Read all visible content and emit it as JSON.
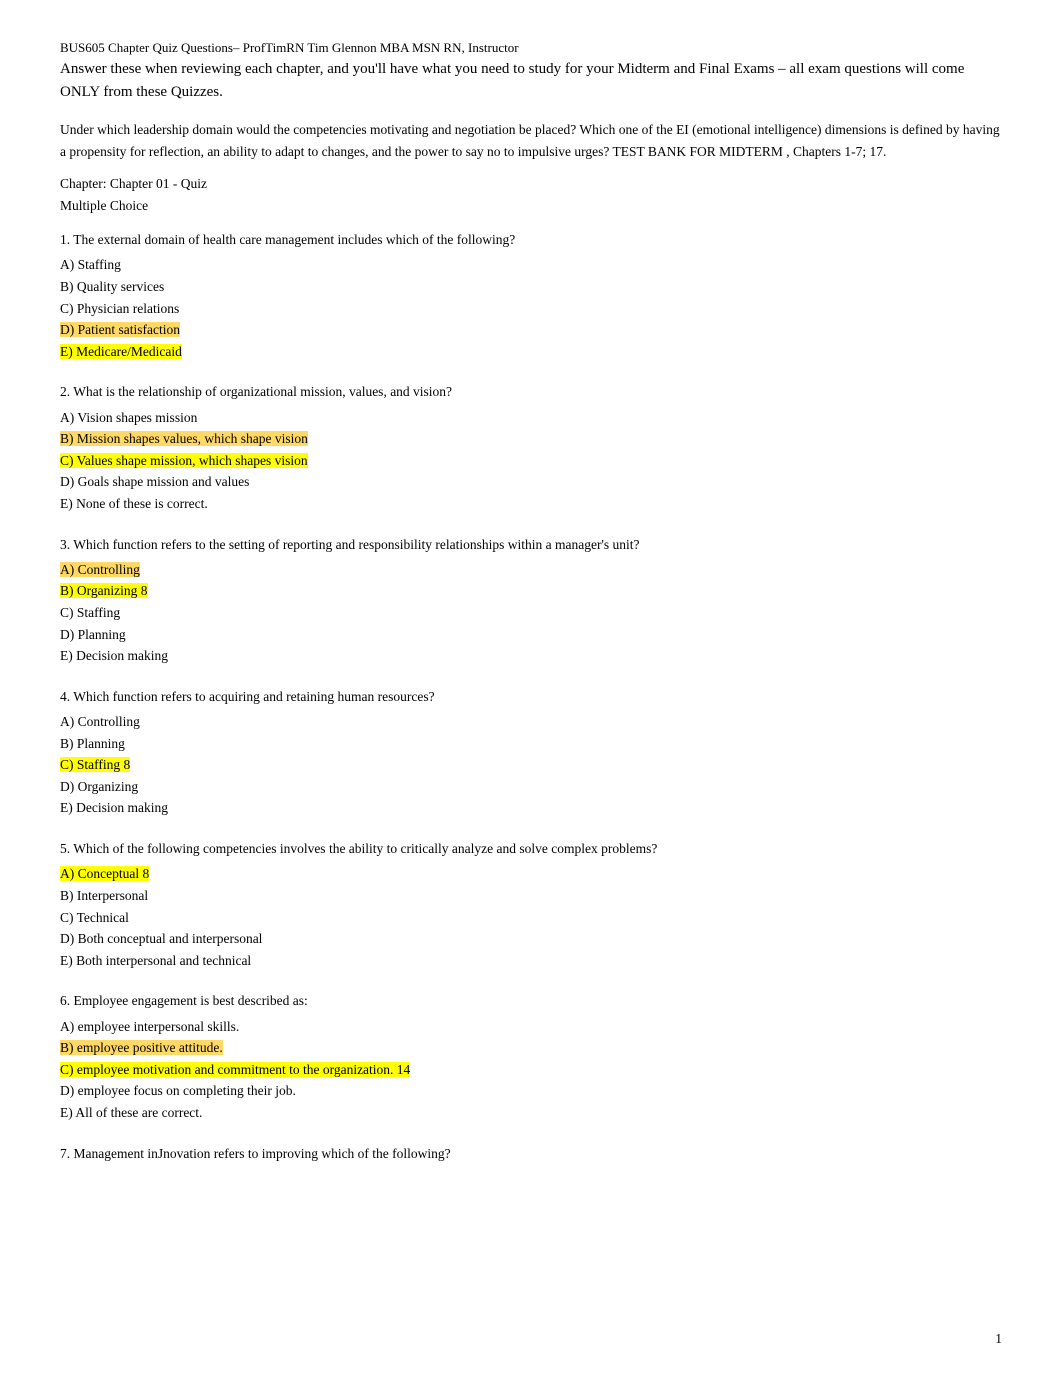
{
  "header": {
    "line1": "BUS605 Chapter Quiz Questions– ProfTimRN Tim Glennon MBA MSN RN, Instructor",
    "line2": "Answer these when reviewing each chapter, and you'll have what you need to study for your    Midterm and Final Exams – all exam questions will come ONLY from these Quizzes."
  },
  "intro": {
    "text": "Under which leadership domain would the competencies      motivating and negotiation  be placed? Which one of the EI (emotional intelligence) dimensions is defined by having a propensity for reflection, an ability to adapt to changes, and the power to say no to impulsive urges?       TEST BANK FOR MIDTERM , Chapters 1-7; 17."
  },
  "chapter_label": "Chapter: Chapter 01 - Quiz",
  "type_label": "Multiple Choice",
  "questions": [
    {
      "number": "1",
      "text": "The external domain of health care management includes which of the following?",
      "options": [
        {
          "letter": "A",
          "text": "Staffing",
          "highlight": ""
        },
        {
          "letter": "B",
          "text": "Quality services",
          "highlight": ""
        },
        {
          "letter": "C",
          "text": "Physician relations",
          "highlight": ""
        },
        {
          "letter": "D",
          "text": "Patient satisfaction",
          "highlight": "orange"
        },
        {
          "letter": "E",
          "text": "Medicare/Medicaid",
          "highlight": "yellow"
        }
      ]
    },
    {
      "number": "2",
      "text": "What is the relationship of organizational mission, values, and vision?",
      "options": [
        {
          "letter": "A",
          "text": "Vision shapes mission",
          "highlight": ""
        },
        {
          "letter": "B",
          "text": "Mission shapes values, which shape vision",
          "highlight": "orange"
        },
        {
          "letter": "C",
          "text": "Values shape mission, which shapes vision",
          "highlight": "yellow"
        },
        {
          "letter": "D",
          "text": "Goals shape mission and values",
          "highlight": ""
        },
        {
          "letter": "E",
          "text": "None of these is correct.",
          "highlight": ""
        }
      ]
    },
    {
      "number": "3",
      "text": "Which function refers to the setting of reporting and responsibility relationships within a manager's unit?",
      "options": [
        {
          "letter": "A",
          "text": "Controlling",
          "highlight": "orange"
        },
        {
          "letter": "B",
          "text": "Organizing    8",
          "highlight": "yellow"
        },
        {
          "letter": "C",
          "text": "Staffing",
          "highlight": ""
        },
        {
          "letter": "D",
          "text": "Planning",
          "highlight": ""
        },
        {
          "letter": "E",
          "text": "Decision making",
          "highlight": ""
        }
      ]
    },
    {
      "number": "4",
      "text": "Which function refers to acquiring and retaining human resources?",
      "options": [
        {
          "letter": "A",
          "text": "Controlling",
          "highlight": ""
        },
        {
          "letter": "B",
          "text": "Planning",
          "highlight": ""
        },
        {
          "letter": "C",
          "text": "Staffing 8",
          "highlight": "yellow"
        },
        {
          "letter": "D",
          "text": "Organizing",
          "highlight": ""
        },
        {
          "letter": "E",
          "text": "Decision making",
          "highlight": ""
        }
      ]
    },
    {
      "number": "5",
      "text": "Which of the following competencies involves the ability to critically analyze and solve complex problems?",
      "options": [
        {
          "letter": "A",
          "text": "Conceptual 8",
          "highlight": "yellow"
        },
        {
          "letter": "B",
          "text": "Interpersonal",
          "highlight": ""
        },
        {
          "letter": "C",
          "text": "Technical",
          "highlight": ""
        },
        {
          "letter": "D",
          "text": "Both conceptual and interpersonal",
          "highlight": ""
        },
        {
          "letter": "E",
          "text": "Both interpersonal and technical",
          "highlight": ""
        }
      ]
    },
    {
      "number": "6",
      "text": "Employee engagement is best described as:",
      "options": [
        {
          "letter": "A",
          "text": "employee interpersonal skills.",
          "highlight": ""
        },
        {
          "letter": "B",
          "text": "employee positive attitude.",
          "highlight": "orange"
        },
        {
          "letter": "C",
          "text": "employee motivation and commitment to the organization. 14",
          "highlight": "yellow"
        },
        {
          "letter": "D",
          "text": "employee focus on completing their job.",
          "highlight": ""
        },
        {
          "letter": "E",
          "text": "All of these are correct.",
          "highlight": ""
        }
      ]
    },
    {
      "number": "7",
      "text": "Management inJnovation refers to improving which of the following?",
      "options": []
    }
  ],
  "page_number": "1"
}
